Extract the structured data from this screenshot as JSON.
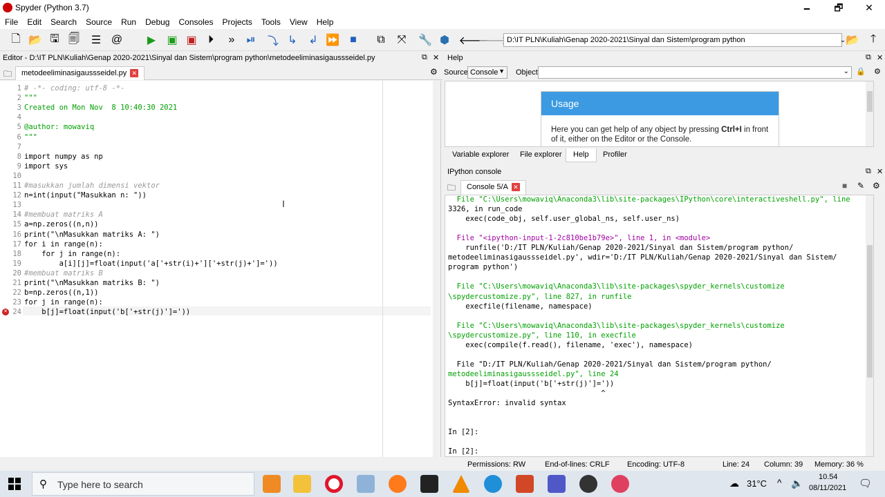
{
  "window": {
    "title": "Spyder (Python 3.7)",
    "minimize": "🗕",
    "maximize": "🗗",
    "close": "✕"
  },
  "menu": [
    "File",
    "Edit",
    "Search",
    "Source",
    "Run",
    "Debug",
    "Consoles",
    "Projects",
    "Tools",
    "View",
    "Help"
  ],
  "toolbar": {
    "path": "D:\\IT PLN\\Kuliah\\Genap 2020-2021\\Sinyal dan Sistem\\program python"
  },
  "editor": {
    "header": "Editor - D:\\IT PLN\\Kuliah\\Genap 2020-2021\\Sinyal dan Sistem\\program python\\metodeeliminasigaussseidel.py",
    "tab": "metodeeliminasigaussseidel.py",
    "lines": [
      "# -*- coding: utf-8 -*-",
      "\"\"\"",
      "Created on Mon Nov  8 10:40:30 2021",
      "",
      "@author: mowaviq",
      "\"\"\"",
      "",
      "import numpy as np",
      "import sys",
      "",
      "#masukkan jumlah dimensi vektor",
      "n=int(input(\"Masukkan n: \"))",
      "",
      "#membuat matriks A",
      "a=np.zeros((n,n))",
      "print(\"\\nMasukkan matriks A: \")",
      "for i in range(n):",
      "    for j in range(n):",
      "        a[i][j]=float(input('a['+str(i)+']['+str(j)+']='))",
      "#membuat matriks B",
      "print(\"\\nMasukkan matriks B: \")",
      "b=np.zeros((n,1))",
      "for j in range(n):",
      "    b[j]=float(input('b['+str(j)']='))"
    ]
  },
  "help": {
    "header": "Help",
    "source_label": "Source",
    "source_value": "Console",
    "object_label": "Object",
    "usage_title": "Usage",
    "usage_text_1": "Here you can get help of any object by pressing ",
    "usage_key": "Ctrl+I",
    "usage_text_2": " in front of it, either on the Editor or the Console."
  },
  "pane_tabs": [
    "Variable explorer",
    "File explorer",
    "Help",
    "Profiler"
  ],
  "console": {
    "header": "IPython console",
    "tab": "Console 5/A",
    "lines": [
      "  File \"C:\\Users\\mowaviq\\Anaconda3\\lib\\site-packages\\IPython\\core\\interactiveshell.py\", line",
      "3326, in run_code",
      "    exec(code_obj, self.user_global_ns, self.user_ns)",
      "",
      "  File \"<ipython-input-1-2c810be1b79e>\", line 1, in <module>",
      "    runfile('D:/IT PLN/Kuliah/Genap 2020-2021/Sinyal dan Sistem/program python/",
      "metodeeliminasigaussseidel.py', wdir='D:/IT PLN/Kuliah/Genap 2020-2021/Sinyal dan Sistem/",
      "program python')",
      "",
      "  File \"C:\\Users\\mowaviq\\Anaconda3\\lib\\site-packages\\spyder_kernels\\customize",
      "\\spydercustomize.py\", line 827, in runfile",
      "    execfile(filename, namespace)",
      "",
      "  File \"C:\\Users\\mowaviq\\Anaconda3\\lib\\site-packages\\spyder_kernels\\customize",
      "\\spydercustomize.py\", line 110, in execfile",
      "    exec(compile(f.read(), filename, 'exec'), namespace)",
      "",
      "  File \"D:/IT PLN/Kuliah/Genap 2020-2021/Sinyal dan Sistem/program python/",
      "metodeeliminasigaussseidel.py\", line 24",
      "    b[j]=float(input('b['+str(j)']='))",
      "                                   ^",
      "SyntaxError: invalid syntax",
      "",
      "",
      "In [2]:",
      "",
      "In [2]:"
    ]
  },
  "status": {
    "permissions": "Permissions: RW",
    "eol": "End-of-lines: CRLF",
    "encoding": "Encoding: UTF-8",
    "line": "Line: 24",
    "column": "Column: 39",
    "memory": "Memory: 36 %"
  },
  "taskbar": {
    "search_placeholder": "Type here to search",
    "temperature": "31°C",
    "time": "10.54",
    "date": "08/11/2021"
  }
}
